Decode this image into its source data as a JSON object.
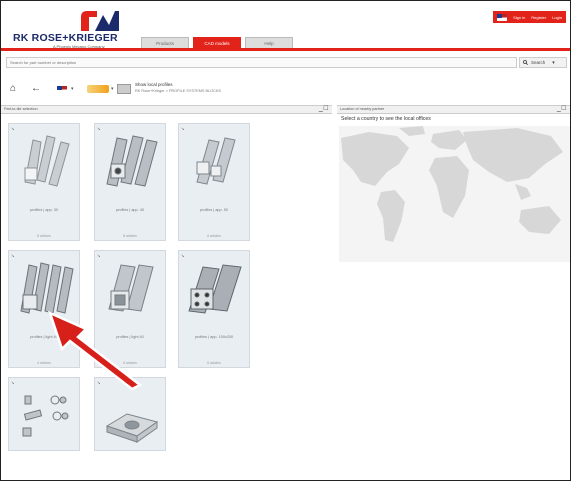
{
  "header": {
    "logo_text": "RK ROSE+KRIEGER",
    "logo_sub": "A Phoenix Mecano Company",
    "topnav": [
      "Sign in",
      "Register",
      "Login"
    ],
    "tabs": [
      {
        "label": "Products",
        "active": false
      },
      {
        "label": "CAD models",
        "active": true
      },
      {
        "label": "Help",
        "active": false
      }
    ]
  },
  "search": {
    "placeholder": "Search for part number or description",
    "button_label": "Search"
  },
  "toolbar": {
    "title": "Show local profiles",
    "path": "RK Rose+Krieger > PROFILE SYSTEMS BLOCKS"
  },
  "left_panel": {
    "title": "Part-to-tile selection",
    "tiles": [
      {
        "name": "profiles | app. 30",
        "meta": "8 articles"
      },
      {
        "name": "profiles | app. 40",
        "meta": "8 articles"
      },
      {
        "name": "profiles | app. 50",
        "meta": "6 articles"
      },
      {
        "name": "profiles | light 40",
        "meta": "4 articles"
      },
      {
        "name": "profiles | light 40",
        "meta": "6 articles"
      },
      {
        "name": "profiles | app. 100x200",
        "meta": "6 articles"
      },
      {
        "name": "",
        "meta": ""
      },
      {
        "name": "",
        "meta": ""
      }
    ]
  },
  "right_panel": {
    "title": "Location of nearby partner",
    "hint": "Select a country to see the local offices"
  },
  "colors": {
    "brand_red": "#e2231a",
    "brand_blue": "#1b2a6b"
  }
}
